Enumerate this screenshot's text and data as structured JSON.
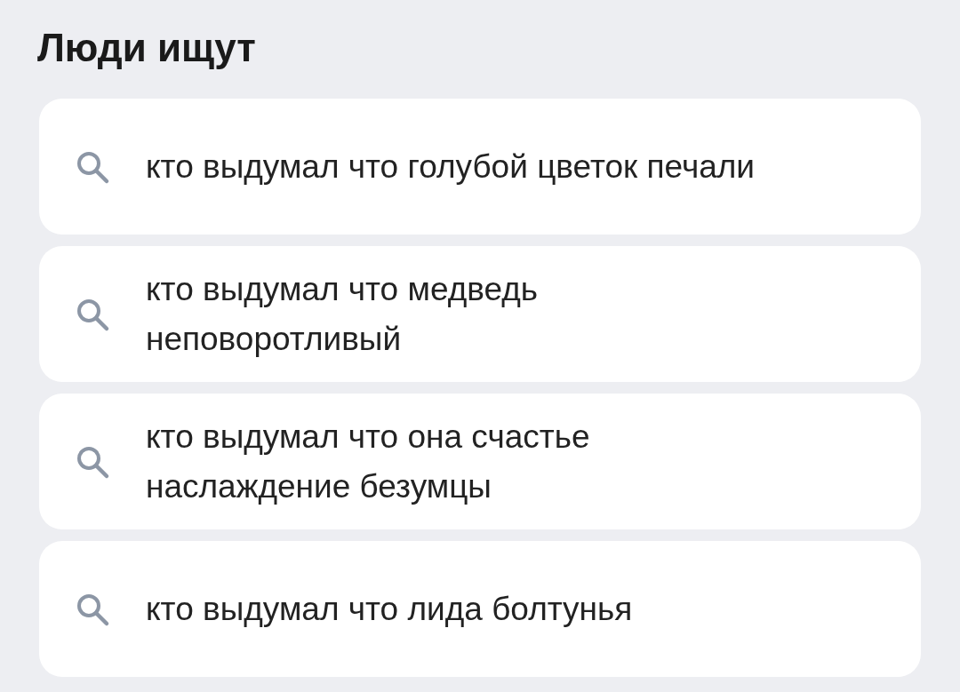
{
  "section": {
    "title": "Люди ищут"
  },
  "suggestions": [
    {
      "text": "кто выдумал что голубой цветок печали"
    },
    {
      "text": "кто выдумал что медведь неповоротливый"
    },
    {
      "text": "кто выдумал что она счастье наслаждение безумцы"
    },
    {
      "text": "кто выдумал что лида болтунья"
    }
  ]
}
